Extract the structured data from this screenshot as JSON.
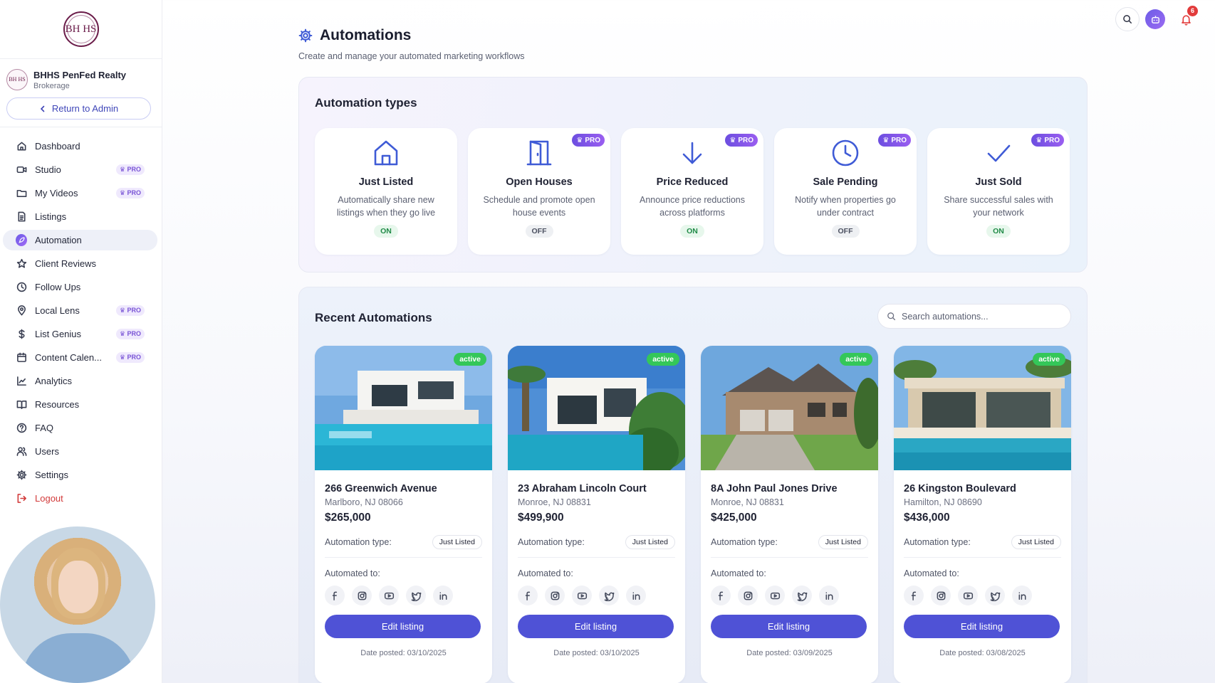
{
  "brand": {
    "logo_text": "BH HS",
    "accent": "#4f52d6",
    "pro_accent": "#7a55d6"
  },
  "org": {
    "avatar_text": "BH HS",
    "name": "BHHS PenFed Realty",
    "type": "Brokerage",
    "return_label": "Return to Admin"
  },
  "nav": [
    {
      "label": "Dashboard",
      "icon": "home-icon",
      "pro": ""
    },
    {
      "label": "Studio",
      "icon": "video-icon",
      "pro": "PRO"
    },
    {
      "label": "My Videos",
      "icon": "folder-icon",
      "pro": "PRO"
    },
    {
      "label": "Listings",
      "icon": "document-icon",
      "pro": ""
    },
    {
      "label": "Automation",
      "icon": "rocket-icon",
      "pro": "",
      "active": true
    },
    {
      "label": "Client Reviews",
      "icon": "star-icon",
      "pro": ""
    },
    {
      "label": "Follow Ups",
      "icon": "clock-icon",
      "pro": ""
    },
    {
      "label": "Local Lens",
      "icon": "map-pin-icon",
      "pro": "PRO"
    },
    {
      "label": "List Genius",
      "icon": "dollar-icon",
      "pro": "PRO"
    },
    {
      "label": "Content Calen...",
      "icon": "calendar-icon",
      "pro": "PRO"
    },
    {
      "label": "Analytics",
      "icon": "chart-icon",
      "pro": ""
    },
    {
      "label": "Resources",
      "icon": "book-icon",
      "pro": ""
    },
    {
      "label": "FAQ",
      "icon": "help-icon",
      "pro": ""
    },
    {
      "label": "Users",
      "icon": "users-icon",
      "pro": ""
    },
    {
      "label": "Settings",
      "icon": "gear-icon",
      "pro": ""
    },
    {
      "label": "Logout",
      "icon": "logout-icon",
      "pro": ""
    }
  ],
  "topbar": {
    "notification_count": "6"
  },
  "page": {
    "title": "Automations",
    "subtitle": "Create and manage your automated marketing workflows"
  },
  "types": {
    "title": "Automation types",
    "items": [
      {
        "name": "Just Listed",
        "desc": "Automatically share new listings when they go live",
        "status": "ON",
        "pro": "",
        "icon": "house-icon"
      },
      {
        "name": "Open Houses",
        "desc": "Schedule and promote open house events",
        "status": "OFF",
        "pro": "PRO",
        "icon": "door-icon"
      },
      {
        "name": "Price Reduced",
        "desc": "Announce price reductions across platforms",
        "status": "ON",
        "pro": "PRO",
        "icon": "arrow-down-icon"
      },
      {
        "name": "Sale Pending",
        "desc": "Notify when properties go under contract",
        "status": "OFF",
        "pro": "PRO",
        "icon": "clock-icon"
      },
      {
        "name": "Just Sold",
        "desc": "Share successful sales with your network",
        "status": "ON",
        "pro": "PRO",
        "icon": "check-icon"
      }
    ]
  },
  "recent": {
    "title": "Recent Automations",
    "search_placeholder": "Search automations...",
    "type_label": "Automation type:",
    "automated_label": "Automated to:",
    "edit_label": "Edit listing",
    "social_icons": [
      "facebook-icon",
      "instagram-icon",
      "youtube-icon",
      "twitter-icon",
      "linkedin-icon"
    ],
    "listings": [
      {
        "status": "active",
        "address": "266 Greenwich Avenue",
        "city": "Marlboro, NJ 08066",
        "price": "$265,000",
        "type": "Just Listed",
        "date": "Date posted: 03/10/2025"
      },
      {
        "status": "active",
        "address": "23 Abraham Lincoln Court",
        "city": "Monroe, NJ 08831",
        "price": "$499,900",
        "type": "Just Listed",
        "date": "Date posted: 03/10/2025"
      },
      {
        "status": "active",
        "address": "8A John Paul Jones Drive",
        "city": "Monroe, NJ 08831",
        "price": "$425,000",
        "type": "Just Listed",
        "date": "Date posted: 03/09/2025"
      },
      {
        "status": "active",
        "address": "26 Kingston Boulevard",
        "city": "Hamilton, NJ 08690",
        "price": "$436,000",
        "type": "Just Listed",
        "date": "Date posted: 03/08/2025"
      }
    ]
  }
}
